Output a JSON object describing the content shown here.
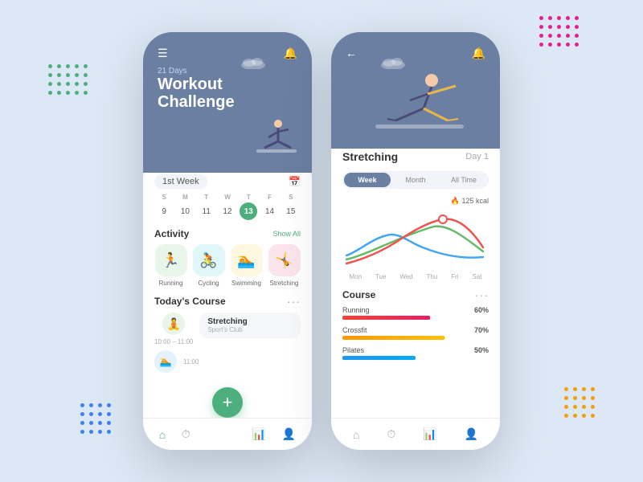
{
  "background": "#dce8f5",
  "accent": "#4caf7d",
  "header_blue": "#6b7fa3",
  "decorative": {
    "dots_tl": {
      "color": "#4caf7d",
      "count": 20
    },
    "dots_tr": {
      "color": "#e91e8c",
      "count": 20
    },
    "dots_bl": {
      "color": "#3b82f6",
      "count": 16
    },
    "dots_br": {
      "color": "#f59e0b",
      "count": 16
    }
  },
  "left_phone": {
    "subtitle": "21 Days",
    "title": "Workout\nChallenge",
    "week_label": "1st Week",
    "calendar": {
      "headers": [
        "S",
        "M",
        "T",
        "W",
        "T",
        "F",
        "S"
      ],
      "days": [
        "9",
        "10",
        "11",
        "12",
        "13",
        "14",
        "15"
      ],
      "active_index": 4
    },
    "activity": {
      "title": "Activity",
      "show_all": "Show All",
      "items": [
        {
          "label": "Running",
          "emoji": "🏃",
          "color": "green"
        },
        {
          "label": "Cycling",
          "emoji": "🚴",
          "color": "teal"
        },
        {
          "label": "Swimming",
          "emoji": "🏊",
          "color": "yellow"
        },
        {
          "label": "Stretching",
          "emoji": "🤸",
          "color": "pink"
        }
      ]
    },
    "course": {
      "title": "Today's Course",
      "items": [
        {
          "time": "10:00 - 11:00",
          "name": "Stretching",
          "sub": "Sport's Club",
          "emoji": "🧘"
        }
      ]
    },
    "bottom_nav": [
      "🏠",
      "⏱",
      "📊",
      "👤"
    ]
  },
  "right_phone": {
    "title": "Stretching",
    "day_label": "Day 1",
    "tabs": [
      "Week",
      "Month",
      "All Time"
    ],
    "active_tab": 0,
    "kcal": "🔥 125 kcal",
    "chart_labels": [
      "Mon",
      "Tue",
      "Wed",
      "Thu",
      "Fri",
      "Sat"
    ],
    "course_section_title": "Course",
    "courses": [
      {
        "name": "Running",
        "pct": "60%",
        "value": 60,
        "colors": [
          "#f44336",
          "#e91e63"
        ]
      },
      {
        "name": "Crossfit",
        "pct": "70%",
        "value": 70,
        "colors": [
          "#ff9800",
          "#ffc107"
        ]
      },
      {
        "name": "Pilates",
        "pct": "50%",
        "value": 50,
        "colors": [
          "#2196f3",
          "#03a9f4"
        ]
      }
    ],
    "bottom_nav": [
      "🏠",
      "⏱",
      "📊",
      "👤"
    ]
  }
}
